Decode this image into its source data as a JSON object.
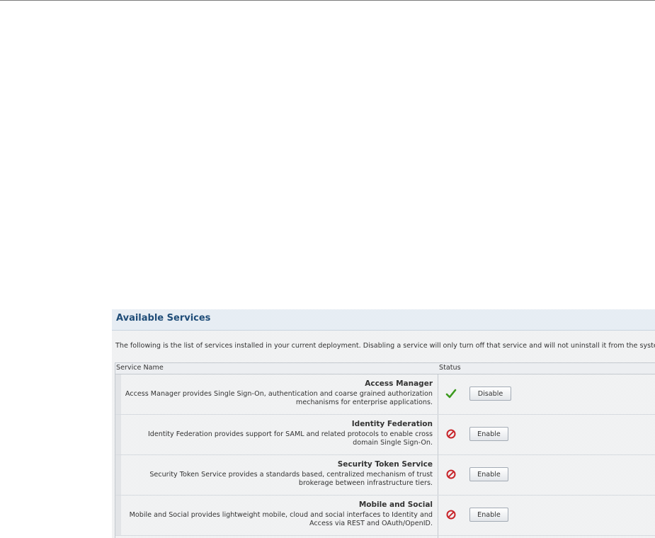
{
  "panel": {
    "title": "Available Services",
    "intro": "The following is the list of services installed in your current deployment. Disabling a service will only turn off that service and will not uninstall it from the system",
    "columns": {
      "name": "Service Name",
      "status": "Status"
    }
  },
  "services": [
    {
      "name": "Access Manager",
      "description": "Access Manager provides Single Sign-On, authentication and coarse grained authorization mechanisms for enterprise applications.",
      "status_icon": "check-icon",
      "action_label": "Disable"
    },
    {
      "name": "Identity Federation",
      "description": "Identity Federation provides support for SAML and related protocols to enable cross domain Single Sign-On.",
      "status_icon": "disabled-icon",
      "action_label": "Enable"
    },
    {
      "name": "Security Token Service",
      "description": "Security Token Service provides a standards based, centralized mechanism of trust brokerage between infrastructure tiers.",
      "status_icon": "disabled-icon",
      "action_label": "Enable"
    },
    {
      "name": "Mobile and Social",
      "description": "Mobile and Social provides lightweight mobile, cloud and social interfaces to Identity and Access via REST and OAuth/OpenID.",
      "status_icon": "disabled-icon",
      "action_label": "Enable"
    }
  ],
  "colors": {
    "title": "#1f4d78",
    "enabled": "#3c9a1e",
    "disabled": "#c8242a"
  }
}
